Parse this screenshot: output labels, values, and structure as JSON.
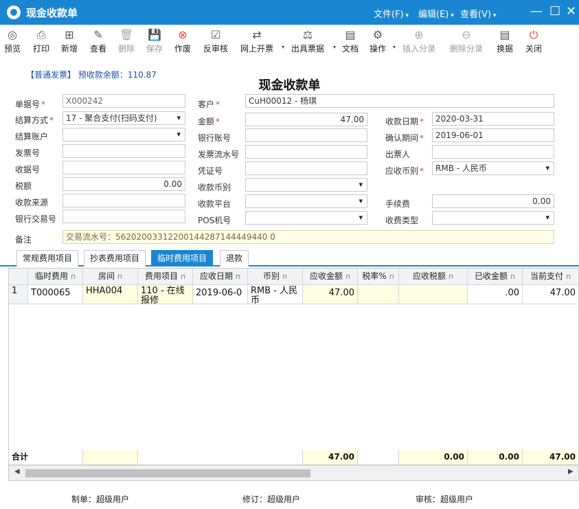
{
  "window": {
    "title": "现金收款单",
    "menus": [
      "文件(F)",
      "编辑(E)",
      "查看(V)"
    ],
    "controls": {
      "minimize": "—",
      "maximize": "☐",
      "close": "✕"
    }
  },
  "toolbar": [
    {
      "label": "预览",
      "icon": "◎"
    },
    {
      "label": "打印",
      "icon": "⎙"
    },
    {
      "label": "新增",
      "icon": "⊞"
    },
    {
      "label": "查看",
      "icon": "✎"
    },
    {
      "label": "删除",
      "icon": "🗑"
    },
    {
      "label": "保存",
      "icon": "💾"
    },
    {
      "label": "作废",
      "icon": "⊗"
    },
    {
      "label": "反审核",
      "icon": "☑"
    },
    {
      "label": "网上开票",
      "icon": "⇄"
    },
    {
      "label": "出具票据",
      "icon": "⚖"
    },
    {
      "label": "文档",
      "icon": "▤"
    },
    {
      "label": "操作",
      "icon": "⚙"
    },
    {
      "label": "插入分录",
      "icon": "⊕"
    },
    {
      "label": "删除分录",
      "icon": "⊖"
    },
    {
      "label": "换据",
      "icon": "▤"
    },
    {
      "label": "关闭",
      "icon": "⏻"
    }
  ],
  "header": {
    "invoice_type": "【普通发票】 预收款余额：110.87",
    "form_title": "现金收款单"
  },
  "fields": {
    "doc_no": {
      "label": "单据号",
      "value": "X000242"
    },
    "customer": {
      "label": "客户",
      "value": "CuH00012 - 杨琪"
    },
    "settle_method": {
      "label": "结算方式",
      "value": "17 - 聚合支付(扫码支付)"
    },
    "amount": {
      "label": "金额",
      "value": "47.00"
    },
    "receipt_date": {
      "label": "收款日期",
      "value": "2020-03-31"
    },
    "settle_account": {
      "label": "结算账户",
      "value": ""
    },
    "bank_account": {
      "label": "银行账号",
      "value": ""
    },
    "confirm_period": {
      "label": "确认期间",
      "value": "2019-06-01"
    },
    "invoice_no": {
      "label": "发票号",
      "value": ""
    },
    "invoice_serial": {
      "label": "发票流水号",
      "value": ""
    },
    "drawer": {
      "label": "出票人",
      "value": ""
    },
    "receipt_no": {
      "label": "收据号",
      "value": ""
    },
    "voucher_no": {
      "label": "凭证号",
      "value": ""
    },
    "currency": {
      "label": "应收币别",
      "value": "RMB - 人民币"
    },
    "tax": {
      "label": "税额",
      "value": "0.00"
    },
    "receipt_currency": {
      "label": "收款币别",
      "value": ""
    },
    "receipt_source": {
      "label": "收款来源",
      "value": ""
    },
    "receipt_platform": {
      "label": "收款平台",
      "value": ""
    },
    "fee": {
      "label": "手续费",
      "value": "0.00"
    },
    "bank_txn_no": {
      "label": "银行交易号",
      "value": ""
    },
    "pos": {
      "label": "POS机号",
      "value": ""
    },
    "charge_type": {
      "label": "收费类型",
      "value": ""
    },
    "remark": {
      "label": "备注",
      "value": "交易流水号：56202003312200144287144449440 0"
    }
  },
  "tabs": [
    "常规费用项目",
    "抄表费用项目",
    "临时费用项目",
    "退款"
  ],
  "grid": {
    "columns": [
      "临时费用",
      "房间",
      "费用项目",
      "应收日期",
      "币别",
      "应收金额",
      "税率%",
      "应收税额",
      "已收金额",
      "当前支付"
    ],
    "rows": [
      {
        "index": "1",
        "cells": [
          "T000065",
          "HHA004",
          "110 - 在线报修",
          "2019-06-0",
          "RMB - 人民币",
          "47.00",
          "",
          "",
          ".00",
          "47.00"
        ]
      }
    ],
    "total_label": "合计",
    "totals": [
      "",
      "",
      "",
      "",
      "",
      "47.00",
      "",
      "0.00",
      "0.00",
      "47.00"
    ]
  },
  "footer": {
    "maker": "制单：超级用户",
    "reviser": "修订：超级用户",
    "auditor": "审核：超级用户"
  },
  "colors": {
    "accent": "#1a86d2",
    "required": "#e23b3b",
    "highlight": "#fffde0"
  }
}
